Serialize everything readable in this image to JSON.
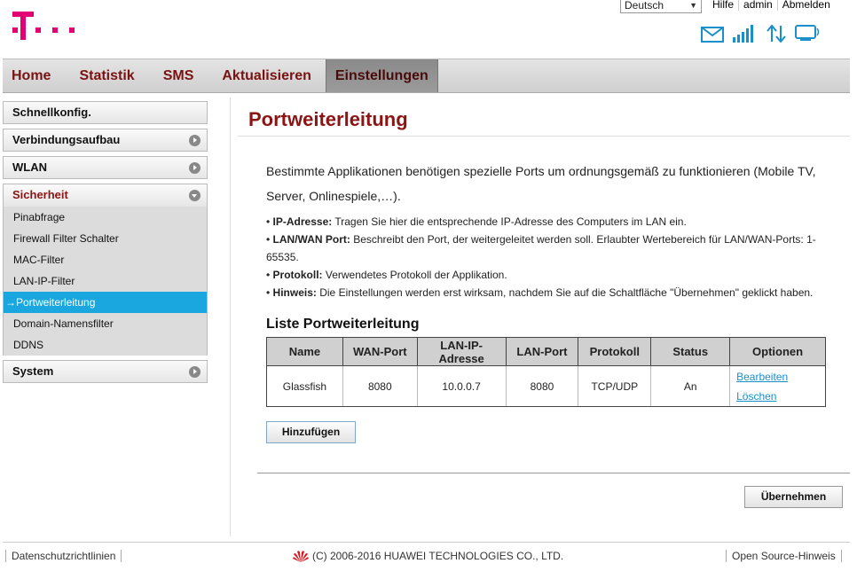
{
  "brand_color": "#e20074",
  "header": {
    "language": "Deutsch",
    "links": [
      "Hilfe",
      "admin",
      "Abmelden"
    ],
    "icons": [
      "mail-icon",
      "signal-icon",
      "data-transfer-icon",
      "monitor-icon"
    ]
  },
  "nav": {
    "items": [
      "Home",
      "Statistik",
      "SMS",
      "Aktualisieren",
      "Einstellungen"
    ],
    "active": "Einstellungen"
  },
  "sidebar": {
    "sections": [
      "Schnellkonfig.",
      "Verbindungsaufbau",
      "WLAN",
      "Sicherheit",
      "System"
    ],
    "security_items": [
      "Pinabfrage",
      "Firewall Filter Schalter",
      "MAC-Filter",
      "LAN-IP-Filter",
      "→Portweiterleitung",
      "Domain-Namensfilter",
      "DDNS"
    ],
    "active_item": "Portweiterleitung"
  },
  "main": {
    "title": "Portweiterleitung",
    "intro": "Bestimmte Applikationen benötigen spezielle Ports um ordnungsgemäß zu funktionieren (Mobile TV, Server, Onlinespiele,…).",
    "bullets": [
      {
        "term": "IP-Adresse:",
        "text": " Tragen Sie hier die entsprechende IP-Adresse des Computers im LAN ein."
      },
      {
        "term": "LAN/WAN Port:",
        "text": " Beschreibt den Port, der weitergeleitet werden soll. Erlaubter Wertebereich für LAN/WAN-Ports: 1-65535."
      },
      {
        "term": "Protokoll:",
        "text": " Verwendetes Protokoll der Applikation."
      },
      {
        "term": "Hinweis:",
        "text": " Die Einstellungen werden erst wirksam, nachdem Sie auf die Schaltfläche \"Übernehmen\" geklickt haben."
      }
    ],
    "list_title": "Liste Portweiterleitung",
    "table": {
      "headers": [
        "Name",
        "WAN-Port",
        "LAN-IP-Adresse",
        "LAN-Port",
        "Protokoll",
        "Status",
        "Optionen"
      ],
      "rows": [
        {
          "name": "Glassfish",
          "wan_port": "8080",
          "lan_ip": "10.0.0.7",
          "lan_port": "8080",
          "protocol": "TCP/UDP",
          "status": "An",
          "edit": "Bearbeiten",
          "delete": "Löschen"
        }
      ]
    },
    "add_button": "Hinzufügen",
    "apply_button": "Übernehmen"
  },
  "footer": {
    "privacy": "Datenschutzrichtlinien",
    "copyright": "(C) 2006-2016 HUAWEI TECHNOLOGIES CO., LTD.",
    "open_source": "Open Source-Hinweis"
  }
}
